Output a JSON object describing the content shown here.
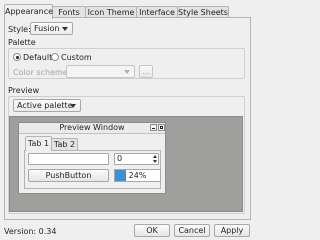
{
  "tabs": [
    {
      "label": "Appearance",
      "active": true
    },
    {
      "label": "Fonts",
      "active": false
    },
    {
      "label": "Icon Theme",
      "active": false
    },
    {
      "label": "Interface",
      "active": false
    },
    {
      "label": "Style Sheets",
      "active": false
    }
  ],
  "style": {
    "label": "Style:",
    "value": "Fusion"
  },
  "palette": {
    "title": "Palette",
    "default_label": "Default",
    "custom_label": "Custom",
    "selected": "Default",
    "color_scheme_label": "Color scheme:",
    "color_scheme_value": "",
    "more_button": "..."
  },
  "preview": {
    "title": "Preview",
    "mode_value": "Active palette",
    "window": {
      "title": "Preview Window",
      "tabs": [
        "Tab 1",
        "Tab 2"
      ],
      "line_edit_value": "",
      "spin_value": "0",
      "push_button": "PushButton",
      "progress_percent": 24,
      "progress_text": "24%"
    }
  },
  "footer": {
    "version": "Version: 0.34",
    "ok": "OK",
    "cancel": "Cancel",
    "apply": "Apply"
  },
  "colors": {
    "accent": "#3d8fd0",
    "preview_background": "#9f9f9d"
  }
}
